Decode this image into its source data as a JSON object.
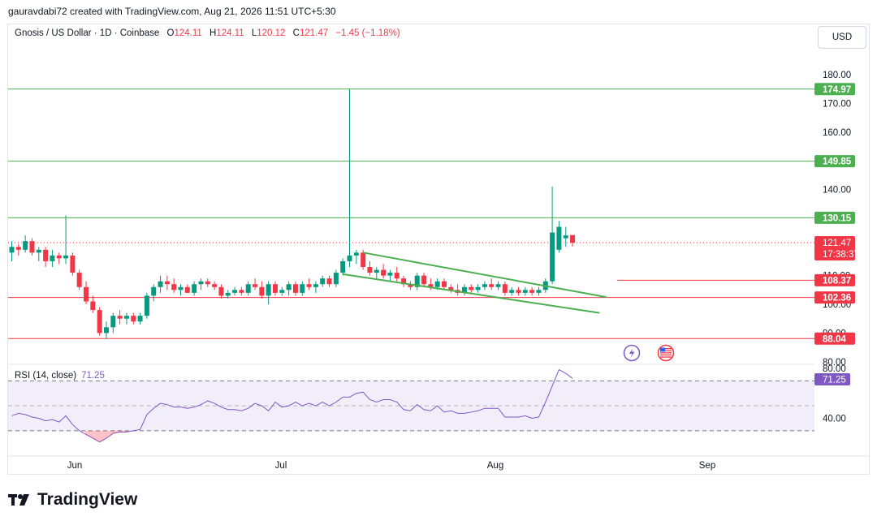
{
  "credit": "gauravdabi72 created with TradingView.com, Aug 21, 2026 11:51 UTC+5:30",
  "legend": {
    "symbol": "Gnosis / US Dollar · 1D · Coinbase",
    "o_label": "O",
    "o_value": "124.11",
    "h_label": "H",
    "h_value": "124.11",
    "l_label": "L",
    "l_value": "120.12",
    "c_label": "C",
    "c_value": "121.47",
    "change": "−1.45 (−1.18%)"
  },
  "currency_button": "USD",
  "logo_text": "TradingView",
  "colors": {
    "up": "#089981",
    "down": "#f23645",
    "support_line": "#f23645",
    "resistance_line": "#4caf50",
    "wedge": "#4caf50",
    "rsi": "#7e57c2",
    "rsi_band": "#7e57c2"
  },
  "chart_data": {
    "type": "candlestick",
    "title": "Gnosis / US Dollar · 1D · Coinbase",
    "y_axis_ticks": [
      "180.00",
      "170.00",
      "160.00",
      "140.00",
      "110.00",
      "100.00",
      "90.00",
      "80.00"
    ],
    "ylim": [
      76,
      186
    ],
    "x_axis_ticks": [
      "Jun",
      "Jul",
      "Aug",
      "Sep"
    ],
    "last_price": "121.47",
    "countdown": "17:38:37",
    "horizontal_levels": [
      {
        "value": 174.97,
        "label": "174.97",
        "kind": "resistance"
      },
      {
        "value": 149.85,
        "label": "149.85",
        "kind": "resistance"
      },
      {
        "value": 130.15,
        "label": "130.15",
        "kind": "resistance"
      },
      {
        "value": 108.37,
        "label": "108.37",
        "kind": "support"
      },
      {
        "value": 102.36,
        "label": "102.36",
        "kind": "support"
      },
      {
        "value": 88.04,
        "label": "88.04",
        "kind": "support"
      }
    ],
    "candles": [
      {
        "o": 118,
        "h": 122,
        "l": 115,
        "c": 120
      },
      {
        "o": 120,
        "h": 121,
        "l": 117,
        "c": 119
      },
      {
        "o": 119,
        "h": 124,
        "l": 118,
        "c": 122
      },
      {
        "o": 122,
        "h": 123,
        "l": 117,
        "c": 118
      },
      {
        "o": 118,
        "h": 120,
        "l": 115,
        "c": 119
      },
      {
        "o": 119,
        "h": 120,
        "l": 113,
        "c": 115
      },
      {
        "o": 115,
        "h": 119,
        "l": 113,
        "c": 117
      },
      {
        "o": 117,
        "h": 118,
        "l": 114,
        "c": 116
      },
      {
        "o": 116,
        "h": 131,
        "l": 114,
        "c": 117
      },
      {
        "o": 117,
        "h": 118,
        "l": 110,
        "c": 111
      },
      {
        "o": 111,
        "h": 112,
        "l": 105,
        "c": 106
      },
      {
        "o": 106,
        "h": 108,
        "l": 100,
        "c": 101
      },
      {
        "o": 101,
        "h": 103,
        "l": 97,
        "c": 98
      },
      {
        "o": 98,
        "h": 99,
        "l": 89,
        "c": 90
      },
      {
        "o": 90,
        "h": 94,
        "l": 88,
        "c": 92
      },
      {
        "o": 92,
        "h": 97,
        "l": 90,
        "c": 96
      },
      {
        "o": 96,
        "h": 98,
        "l": 93,
        "c": 95
      },
      {
        "o": 95,
        "h": 97,
        "l": 93,
        "c": 96
      },
      {
        "o": 96,
        "h": 97,
        "l": 93,
        "c": 94
      },
      {
        "o": 94,
        "h": 97,
        "l": 93,
        "c": 96
      },
      {
        "o": 96,
        "h": 104,
        "l": 95,
        "c": 103
      },
      {
        "o": 103,
        "h": 107,
        "l": 101,
        "c": 106
      },
      {
        "o": 106,
        "h": 110,
        "l": 104,
        "c": 108
      },
      {
        "o": 108,
        "h": 110,
        "l": 105,
        "c": 107
      },
      {
        "o": 107,
        "h": 109,
        "l": 104,
        "c": 105
      },
      {
        "o": 105,
        "h": 107,
        "l": 103,
        "c": 106
      },
      {
        "o": 106,
        "h": 107,
        "l": 104,
        "c": 104
      },
      {
        "o": 104,
        "h": 108,
        "l": 103,
        "c": 107
      },
      {
        "o": 107,
        "h": 109,
        "l": 105,
        "c": 108
      },
      {
        "o": 108,
        "h": 109,
        "l": 106,
        "c": 107
      },
      {
        "o": 107,
        "h": 108,
        "l": 105,
        "c": 106
      },
      {
        "o": 106,
        "h": 107,
        "l": 102,
        "c": 103
      },
      {
        "o": 103,
        "h": 105,
        "l": 102,
        "c": 104
      },
      {
        "o": 104,
        "h": 106,
        "l": 103,
        "c": 105
      },
      {
        "o": 105,
        "h": 106,
        "l": 103,
        "c": 104
      },
      {
        "o": 104,
        "h": 108,
        "l": 103,
        "c": 107
      },
      {
        "o": 107,
        "h": 109,
        "l": 105,
        "c": 106
      },
      {
        "o": 106,
        "h": 108,
        "l": 102,
        "c": 103
      },
      {
        "o": 103,
        "h": 108,
        "l": 100,
        "c": 107
      },
      {
        "o": 107,
        "h": 108,
        "l": 103,
        "c": 104
      },
      {
        "o": 104,
        "h": 106,
        "l": 103,
        "c": 105
      },
      {
        "o": 105,
        "h": 108,
        "l": 103,
        "c": 107
      },
      {
        "o": 107,
        "h": 108,
        "l": 103,
        "c": 104
      },
      {
        "o": 104,
        "h": 108,
        "l": 103,
        "c": 107
      },
      {
        "o": 107,
        "h": 109,
        "l": 105,
        "c": 106
      },
      {
        "o": 106,
        "h": 108,
        "l": 104,
        "c": 107
      },
      {
        "o": 107,
        "h": 110,
        "l": 106,
        "c": 109
      },
      {
        "o": 109,
        "h": 110,
        "l": 106,
        "c": 107
      },
      {
        "o": 107,
        "h": 112,
        "l": 106,
        "c": 111
      },
      {
        "o": 111,
        "h": 116,
        "l": 110,
        "c": 115
      },
      {
        "o": 115,
        "h": 175,
        "l": 113,
        "c": 117
      },
      {
        "o": 117,
        "h": 119,
        "l": 114,
        "c": 118
      },
      {
        "o": 118,
        "h": 119,
        "l": 112,
        "c": 113
      },
      {
        "o": 113,
        "h": 115,
        "l": 110,
        "c": 111
      },
      {
        "o": 111,
        "h": 113,
        "l": 109,
        "c": 112
      },
      {
        "o": 112,
        "h": 114,
        "l": 109,
        "c": 110
      },
      {
        "o": 110,
        "h": 112,
        "l": 108,
        "c": 111
      },
      {
        "o": 111,
        "h": 113,
        "l": 108,
        "c": 109
      },
      {
        "o": 109,
        "h": 110,
        "l": 106,
        "c": 107
      },
      {
        "o": 107,
        "h": 108,
        "l": 105,
        "c": 106
      },
      {
        "o": 106,
        "h": 111,
        "l": 105,
        "c": 110
      },
      {
        "o": 110,
        "h": 111,
        "l": 106,
        "c": 107
      },
      {
        "o": 107,
        "h": 109,
        "l": 105,
        "c": 106
      },
      {
        "o": 106,
        "h": 109,
        "l": 105,
        "c": 108
      },
      {
        "o": 108,
        "h": 109,
        "l": 105,
        "c": 106
      },
      {
        "o": 106,
        "h": 107,
        "l": 104,
        "c": 105
      },
      {
        "o": 105,
        "h": 107,
        "l": 103,
        "c": 104
      },
      {
        "o": 104,
        "h": 107,
        "l": 103,
        "c": 106
      },
      {
        "o": 106,
        "h": 107,
        "l": 104,
        "c": 105
      },
      {
        "o": 105,
        "h": 107,
        "l": 104,
        "c": 106
      },
      {
        "o": 106,
        "h": 108,
        "l": 105,
        "c": 107
      },
      {
        "o": 107,
        "h": 109,
        "l": 105,
        "c": 106
      },
      {
        "o": 106,
        "h": 108,
        "l": 105,
        "c": 107
      },
      {
        "o": 107,
        "h": 108,
        "l": 103,
        "c": 104
      },
      {
        "o": 104,
        "h": 106,
        "l": 103,
        "c": 105
      },
      {
        "o": 105,
        "h": 106,
        "l": 103,
        "c": 104
      },
      {
        "o": 104,
        "h": 106,
        "l": 103,
        "c": 105
      },
      {
        "o": 105,
        "h": 106,
        "l": 103,
        "c": 104
      },
      {
        "o": 104,
        "h": 106,
        "l": 103,
        "c": 105
      },
      {
        "o": 105,
        "h": 109,
        "l": 104,
        "c": 108
      },
      {
        "o": 108,
        "h": 141,
        "l": 107,
        "c": 125
      },
      {
        "o": 119,
        "h": 129,
        "l": 118,
        "c": 127
      },
      {
        "o": 123,
        "h": 127,
        "l": 120,
        "c": 124
      },
      {
        "o": 124.11,
        "h": 124.11,
        "l": 120.12,
        "c": 121.47
      }
    ],
    "wedge_lines": [
      {
        "from": {
          "bar": 52,
          "value": 118
        },
        "to": {
          "bar": 88,
          "value": 102.5
        }
      },
      {
        "from": {
          "bar": 49,
          "value": 110.5
        },
        "to": {
          "bar": 87,
          "value": 97
        }
      }
    ],
    "rsi": {
      "label": "RSI (14, close)",
      "current": "71.25",
      "y_ticks": [
        "80.00",
        "40.00"
      ],
      "upper_band": 70,
      "lower_band": 30,
      "mid": 50,
      "values": [
        42,
        44,
        43,
        41,
        40,
        38,
        39,
        37,
        42,
        35,
        30,
        27,
        24,
        21,
        24,
        28,
        29,
        29,
        30,
        31,
        43,
        48,
        52,
        51,
        49,
        49,
        48,
        49,
        51,
        54,
        52,
        49,
        47,
        47,
        46,
        48,
        52,
        50,
        46,
        53,
        49,
        50,
        53,
        50,
        52,
        50,
        53,
        50,
        53,
        57,
        57,
        60,
        61,
        55,
        53,
        55,
        55,
        53,
        47,
        46,
        51,
        47,
        46,
        50,
        45,
        46,
        44,
        44,
        45,
        46,
        48,
        48,
        48,
        41,
        41,
        41,
        42,
        40,
        41,
        53,
        66,
        79,
        76,
        72
      ]
    }
  }
}
